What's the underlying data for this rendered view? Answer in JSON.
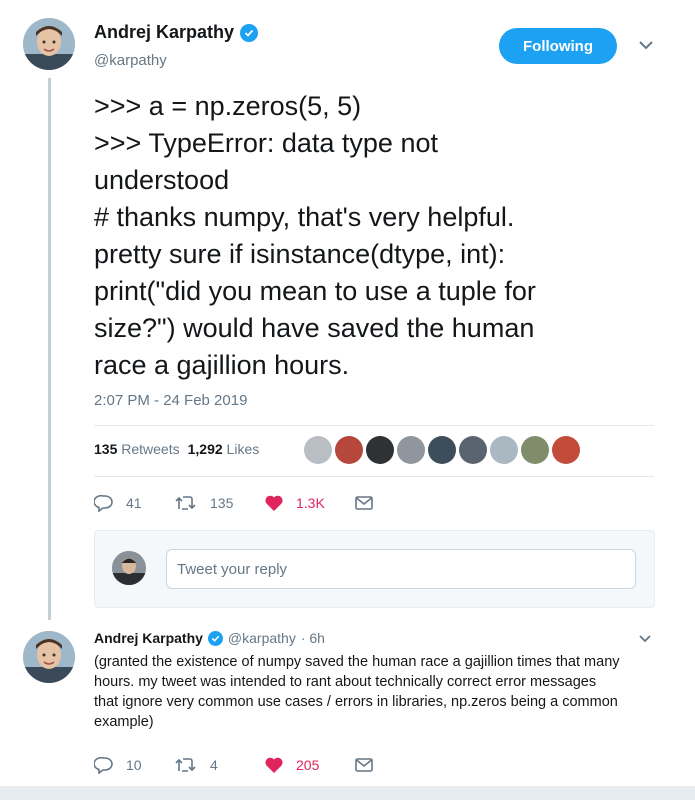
{
  "tweet": {
    "author_name": "Andrej Karpathy",
    "author_handle": "@karpathy",
    "follow_label": "Following",
    "text_lines": [
      ">>> a = np.zeros(5, 5)",
      ">>> TypeError: data type not",
      "understood",
      "# thanks numpy, that's very helpful.",
      "pretty sure if isinstance(dtype, int):",
      "print(\"did you mean to use a tuple for",
      "size?\") would have saved the human",
      "race a gajillion hours."
    ],
    "timestamp": "2:07 PM - 24 Feb 2019",
    "retweets_count": "135",
    "retweets_label": "Retweets",
    "likes_count": "1,292",
    "likes_label": "Likes",
    "actions": {
      "replies": "41",
      "retweets": "135",
      "likes": "1.3K"
    },
    "reply_placeholder": "Tweet your reply"
  },
  "reply": {
    "author_name": "Andrej Karpathy",
    "author_handle": "@karpathy",
    "time": "· 6h",
    "text_lines": [
      "(granted the existence of numpy saved the human race a gajillion times that many",
      "hours. my tweet was intended to rant about technically correct error messages",
      "that ignore very common use cases / errors in libraries, np.zeros being a common",
      "example)"
    ],
    "actions": {
      "replies": "10",
      "retweets": "4",
      "likes": "205"
    }
  },
  "colors": {
    "accent": "#1da1f2",
    "like": "#e0245e",
    "muted": "#657786"
  }
}
